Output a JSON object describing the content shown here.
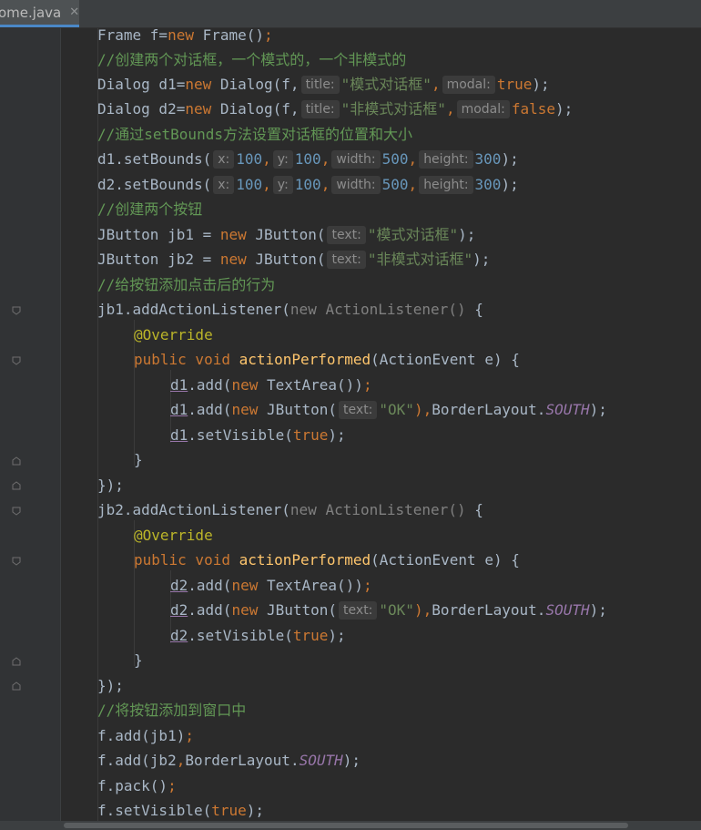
{
  "tab": {
    "label": "ome.java",
    "close_icon": "close-icon"
  },
  "colors": {
    "background": "#2b2b2b",
    "keyword": "#cc7832",
    "number": "#6897bb",
    "string": "#6a8759",
    "comment": "#629755",
    "annotation": "#bbb529",
    "method_decl": "#ffc66d",
    "field": "#9876aa"
  },
  "code": {
    "l1_a": "Frame f=",
    "l1_kw": "new",
    "l1_b": " Frame()",
    "l1_semi": ";",
    "l2": "//创建两个对话框，一个模式的，一个非模式的",
    "l3_a": "Dialog d1=",
    "l3_kw": "new",
    "l3_b": " Dialog(f,",
    "l3_hint1": "title:",
    "l3_str": "\"模式对话框\"",
    "l3_comma": ",",
    "l3_hint2": "modal:",
    "l3_val": "true",
    "l3_end": ");",
    "l4_a": "Dialog d2=",
    "l4_kw": "new",
    "l4_b": " Dialog(f,",
    "l4_hint1": "title:",
    "l4_str": "\"非模式对话框\"",
    "l4_comma": ",",
    "l4_hint2": "modal:",
    "l4_val": "false",
    "l4_end": ");",
    "l5": "//通过setBounds方法设置对话框的位置和大小",
    "l6_a": "d1.setBounds(",
    "l6_h1": "x:",
    "l6_n1": "100",
    "l6_c1": ",",
    "l6_h2": "y:",
    "l6_n2": "100",
    "l6_c2": ",",
    "l6_h3": "width:",
    "l6_n3": "500",
    "l6_c3": ",",
    "l6_h4": "height:",
    "l6_n4": "300",
    "l6_end": ");",
    "l7_a": "d2.setBounds(",
    "l7_h1": "x:",
    "l7_n1": "100",
    "l7_c1": ",",
    "l7_h2": "y:",
    "l7_n2": "100",
    "l7_c2": ",",
    "l7_h3": "width:",
    "l7_n3": "500",
    "l7_c3": ",",
    "l7_h4": "height:",
    "l7_n4": "300",
    "l7_end": ");",
    "l8": "//创建两个按钮",
    "l9_a": "JButton jb1 = ",
    "l9_kw": "new",
    "l9_b": " JButton(",
    "l9_hint": "text:",
    "l9_str": "\"模式对话框\"",
    "l9_end": ");",
    "l10_a": "JButton jb2 = ",
    "l10_kw": "new",
    "l10_b": " JButton(",
    "l10_hint": "text:",
    "l10_str": "\"非模式对话框\"",
    "l10_end": ");",
    "l11": "//给按钮添加点击后的行为",
    "l12_a": "jb1.addActionListener(",
    "l12_g": "new ActionListener()",
    "l12_end": " {",
    "l13": "@Override",
    "l14_kw": "public void",
    "l14_fn": " actionPerformed",
    "l14_end": "(ActionEvent e) {",
    "l15_ref": "d1",
    "l15_a": ".add(",
    "l15_kw": "new",
    "l15_b": " TextArea())",
    "l15_semi": ";",
    "l16_ref": "d1",
    "l16_a": ".add(",
    "l16_kw": "new",
    "l16_b": " JButton(",
    "l16_hint": "text:",
    "l16_str": "\"OK\"",
    "l16_c": "),",
    "l16_d": "BorderLayout.",
    "l16_field": "SOUTH",
    "l16_end": ");",
    "l17_ref": "d1",
    "l17_a": ".setVisible(",
    "l17_kw": "true",
    "l17_end": ");",
    "l18": "}",
    "l19": "});",
    "l20_a": "jb2.addActionListener(",
    "l20_g": "new ActionListener()",
    "l20_end": " {",
    "l21": "@Override",
    "l22_kw": "public void",
    "l22_fn": " actionPerformed",
    "l22_end": "(ActionEvent e) {",
    "l23_ref": "d2",
    "l23_a": ".add(",
    "l23_kw": "new",
    "l23_b": " TextArea())",
    "l23_semi": ";",
    "l24_ref": "d2",
    "l24_a": ".add(",
    "l24_kw": "new",
    "l24_b": " JButton(",
    "l24_hint": "text:",
    "l24_str": "\"OK\"",
    "l24_c": "),",
    "l24_d": "BorderLayout.",
    "l24_field": "SOUTH",
    "l24_end": ");",
    "l25_ref": "d2",
    "l25_a": ".setVisible(",
    "l25_kw": "true",
    "l25_end": ");",
    "l26": "}",
    "l27": "});",
    "l28": "//将按钮添加到窗口中",
    "l29_a": "f.add(jb1)",
    "l29_semi": ";",
    "l30_a": "f.add(jb2",
    "l30_c": ",",
    "l30_b": "BorderLayout.",
    "l30_field": "SOUTH",
    "l30_end": ");",
    "l31_a": "f.pack()",
    "l31_semi": ";",
    "l32_a": "f.setVisible(",
    "l32_kw": "true",
    "l32_end": ");"
  }
}
